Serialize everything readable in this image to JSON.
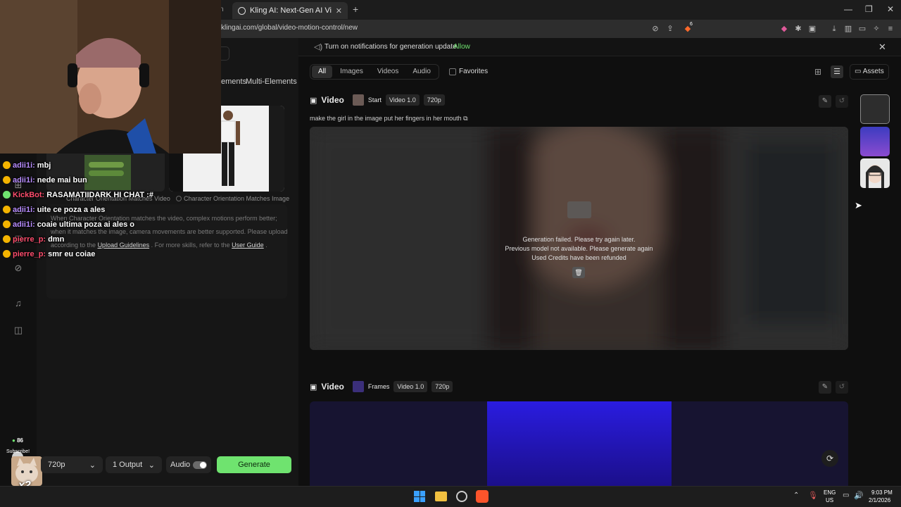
{
  "browser": {
    "tab_prev_fragment": "n",
    "tab_title": "Kling AI: Next-Gen AI Video & AI",
    "url": "klingai.com/global/video-motion-control/new",
    "new_tab": "+",
    "brave_count": "6"
  },
  "chat": [
    {
      "user": "adii1i:",
      "msg": "mbj",
      "color": "#b78cff"
    },
    {
      "user": "adii1i:",
      "msg": "nede mai bun",
      "color": "#b78cff"
    },
    {
      "user": "KickBot:",
      "msg": "RASAMATIIDARK HI CHAT",
      "suffix": ":#",
      "color": "#ff4d6d"
    },
    {
      "user": "adii1i:",
      "msg": "uite ce poza a ales",
      "color": "#b78cff"
    },
    {
      "user": "adii1i:",
      "msg": "coaie ultima poza ai ales o",
      "color": "#b78cff"
    },
    {
      "user": "pierre_p:",
      "msg": "dmn",
      "color": "#ff4d6d"
    },
    {
      "user": "pierre_p:",
      "msg": "smr eu coiae",
      "color": "#ff4d6d"
    }
  ],
  "left": {
    "tab_elements_fragment": "ements",
    "tab_multi": "Multi-Elements",
    "orient1": "Character Orientation Matches Video",
    "orient2": "Character Orientation Matches Image",
    "guide1": "When Character Orientation matches the video, complex motions perform better;",
    "guide2": "when it matches the image, camera movements are better supported. Please upload",
    "guide3_pre": "according to the",
    "guide3_link1": "Upload Guidelines",
    "guide3_mid": ". For more skills, refer to the",
    "guide3_link2": "User Guide",
    "guide3_post": ".",
    "subscribe": "Subscribe!",
    "sub_count": "86",
    "overlay_badge": "x2"
  },
  "controls": {
    "resolution": "720p",
    "output": "1 Output",
    "audio_label": "Audio",
    "generate": "Generate"
  },
  "notification": {
    "text": "Turn on notifications for generation update.",
    "allow": "Allow"
  },
  "filters": {
    "items": [
      "All",
      "Images",
      "Videos",
      "Audio"
    ],
    "favorites": "Favorites",
    "assets": "Assets"
  },
  "video1": {
    "title": "Video",
    "mode": "Start",
    "model": "Video 1.0",
    "res": "720p",
    "prompt": "make the girl in the image put her fingers in her mouth",
    "err1": "Generation failed. Please try again later.",
    "err2": "Previous model not available. Please generate again",
    "err3": "Used Credits have been refunded"
  },
  "video2": {
    "title": "Video",
    "mode": "Frames",
    "model": "Video 1.0",
    "res": "720p"
  },
  "taskbar": {
    "lang1": "ENG",
    "lang2": "US",
    "time": "9:03 PM",
    "date": "2/1/2026"
  }
}
